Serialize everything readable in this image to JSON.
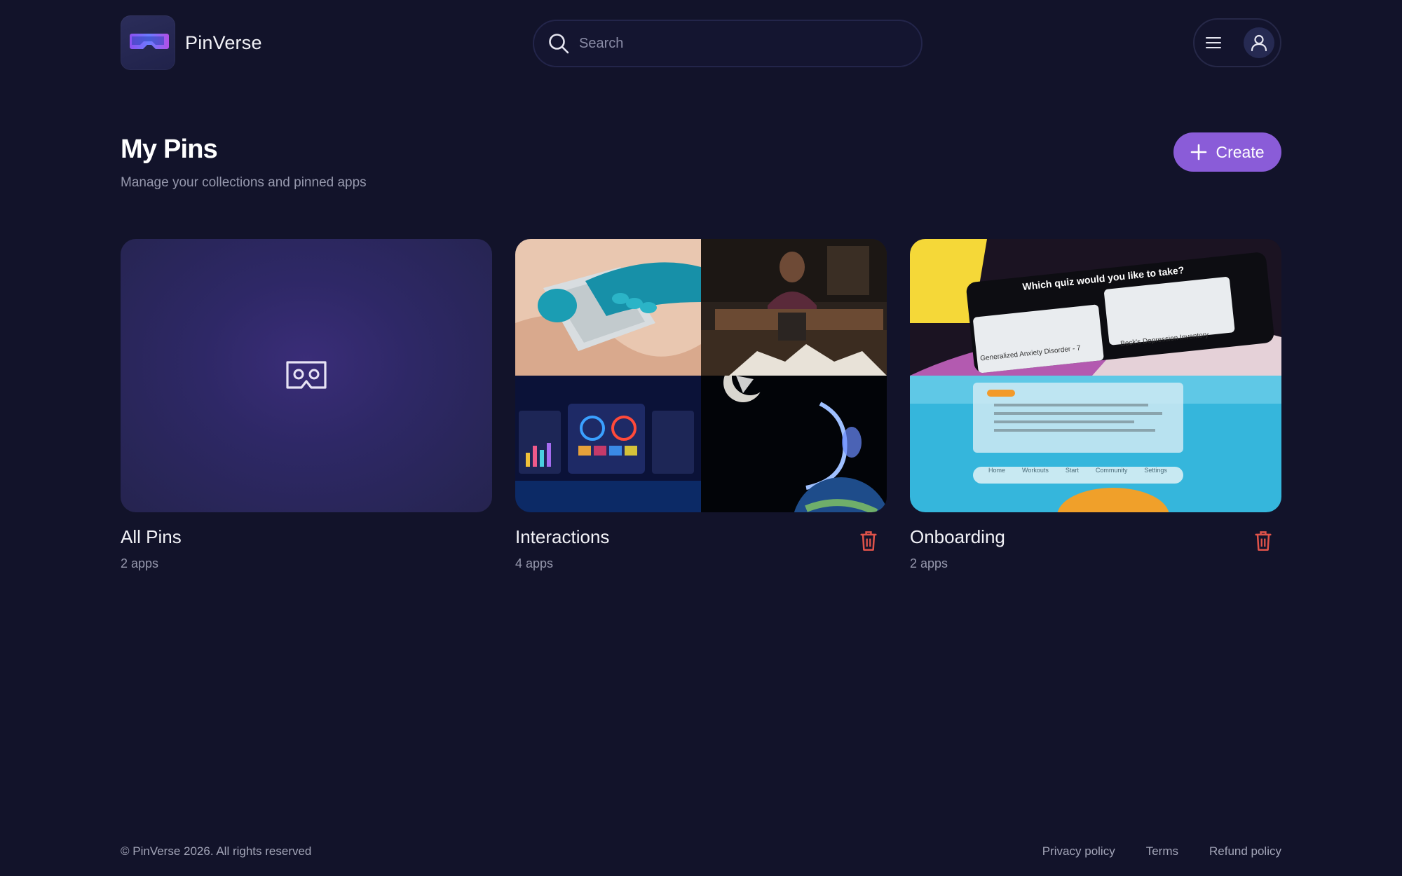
{
  "app": {
    "name": "PinVerse"
  },
  "header": {
    "search_placeholder": "Search",
    "icons": {
      "search": "search-icon",
      "menu": "hamburger-icon",
      "user": "user-icon",
      "logo": "vr-headset-icon"
    }
  },
  "main": {
    "title": "My Pins",
    "subtitle": "Manage your collections and pinned apps",
    "create_label": "Create",
    "collections": [
      {
        "title": "All Pins",
        "count": "2 apps"
      },
      {
        "title": "Interactions",
        "count": "4 apps"
      },
      {
        "title": "Onboarding",
        "count": "2 apps"
      }
    ],
    "thumb_text": {
      "quiz_question": "Which quiz would you like to take?",
      "quiz_option_1": "Generalized Anxiety Disorder - 7",
      "quiz_option_2": "Beck's Depression Inventory",
      "nav": [
        "Home",
        "Workouts",
        "Start",
        "Community",
        "Settings"
      ]
    }
  },
  "footer": {
    "copyright": "© PinVerse 2026. All rights reserved",
    "links": [
      "Privacy policy",
      "Terms",
      "Refund policy"
    ]
  },
  "colors": {
    "background": "#12132a",
    "accent": "#8a5cd8",
    "danger": "#e0534a"
  }
}
